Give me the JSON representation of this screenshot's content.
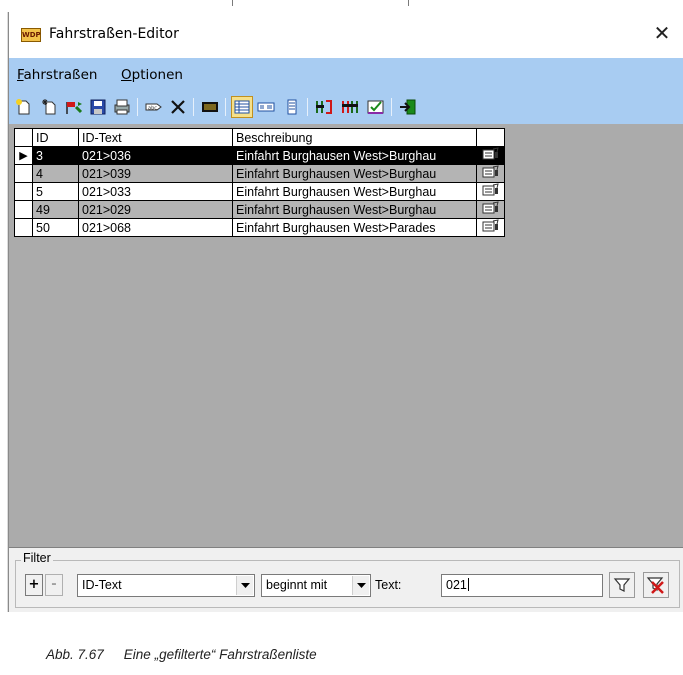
{
  "window": {
    "title": "Fahrstraßen-Editor",
    "app_icon_text": "WDP",
    "close_glyph": "✕"
  },
  "menu": {
    "items": [
      {
        "label": "Fahrstraßen",
        "underline": "F",
        "rest": "ahrstraßen"
      },
      {
        "label": "Optionen",
        "underline": "O",
        "rest": "ptionen"
      }
    ]
  },
  "toolbar": {
    "buttons": [
      "new-icon",
      "new-copy-icon",
      "edit-flag-icon",
      "save-icon",
      "print-icon",
      "tag-icon",
      "delete-icon",
      "signal-panel-icon",
      "table-view-icon",
      "form-view-icon",
      "list-view-icon",
      "route-icon-1",
      "route-icon-2",
      "checklist-icon",
      "exit-icon"
    ]
  },
  "table": {
    "headers": {
      "id": "ID",
      "id_text": "ID-Text",
      "beschreibung": "Beschreibung"
    },
    "rows": [
      {
        "id": "3",
        "id_text": "021>036",
        "beschreibung": "Einfahrt Burghausen West>Burghau",
        "selected": true
      },
      {
        "id": "4",
        "id_text": "021>039",
        "beschreibung": "Einfahrt Burghausen West>Burghau",
        "selected": false
      },
      {
        "id": "5",
        "id_text": "021>033",
        "beschreibung": "Einfahrt Burghausen West>Burghau",
        "selected": false
      },
      {
        "id": "49",
        "id_text": "021>029",
        "beschreibung": "Einfahrt Burghausen West>Burghau",
        "selected": false
      },
      {
        "id": "50",
        "id_text": "021>068",
        "beschreibung": "Einfahrt Burghausen West>Parades",
        "selected": false
      }
    ],
    "selected_indicator": "▶"
  },
  "filter": {
    "legend": "Filter",
    "add_label": "+",
    "remove_label": "-",
    "field_value": "ID-Text",
    "mode_value": "beginnt mit",
    "text_label": "Text:",
    "text_value": "021"
  },
  "caption": {
    "number": "Abb. 7.67",
    "text": "Eine „gefilterte“ Fahrstraßenliste"
  },
  "colors": {
    "menubar": "#a8ccf2",
    "grid_bg": "#ababab",
    "selected_row": "#000000",
    "alt_row": "#b4b4b4"
  }
}
